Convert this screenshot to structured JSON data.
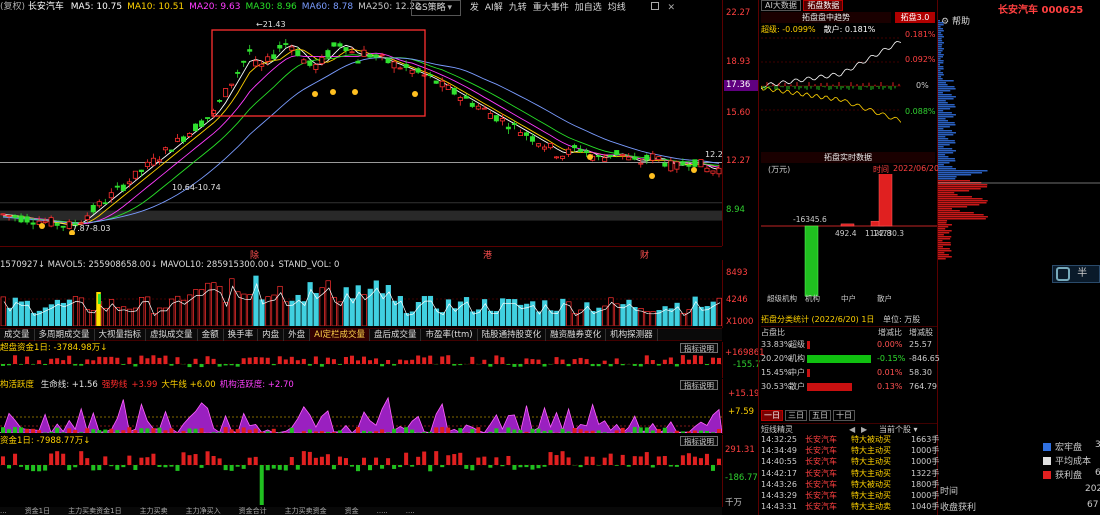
{
  "header": {
    "mode": "(复权)",
    "stock_name": "长安汽车",
    "ma_lines": [
      {
        "label": "MA5: 10.75",
        "color": "#ffffff"
      },
      {
        "label": "MA10: 10.51",
        "color": "#ffd200"
      },
      {
        "label": "MA20: 9.63",
        "color": "#ff3cff"
      },
      {
        "label": "MA30: 8.96",
        "color": "#28e028"
      },
      {
        "label": "MA60: 8.78",
        "color": "#7a9cff"
      },
      {
        "label": "MA250: 12.22",
        "color": "#c8c8c8"
      }
    ],
    "toolbar_select": "GS策略",
    "toolbar_items": [
      "发",
      "AI解",
      "九转",
      "重大事件",
      "加自选",
      "均线"
    ],
    "right_title": "长安汽车 000625"
  },
  "price_axis": [
    "22.27",
    "18.93",
    "17.36",
    "15.60",
    "12.27",
    "8.94"
  ],
  "price_notes": {
    "high": "21.43",
    "range1": "10.64-10.74",
    "range2": "7.87-8.03",
    "range3": "7.25-7.87",
    "low": "6.40",
    "right_price": "12.2"
  },
  "event_marks": [
    "除",
    "港",
    "财"
  ],
  "volume": {
    "header": "1570927↓ MAVOL5: 255908658.00↓ MAVOL10: 285915300.00↓ STAND_VOL: 0",
    "axis": [
      "8493",
      "4246",
      "X1000"
    ]
  },
  "tabs": [
    "成交量",
    "多周期成交量",
    "大视量指标",
    "虚拟成交量",
    "金额",
    "换手率",
    "内盘",
    "外盘",
    "AI定栏成交量",
    "盘后成交量",
    "市盈率(ttm)",
    "陆股通持股变化",
    "融资融券变化",
    "机构探测器"
  ],
  "active_tab_index": 8,
  "panels": {
    "p1_header": "超盘资金1日: -3784.98万↓",
    "p1_axis": [
      "+169861",
      "-155.7"
    ],
    "p2_header_prefix": "构活跃度",
    "p2_items": [
      {
        "label": "生命线: +1.56",
        "color": "#e0e0e0"
      },
      {
        "label": "强势线",
        "color": "#ff2c2c"
      },
      {
        "label": "+3.99",
        "color": "#ff2c2c"
      },
      {
        "label": "大牛线 +6.00",
        "color": "#ffd200"
      },
      {
        "label": "机构活跃度: +2.70",
        "color": "#ff40ff"
      }
    ],
    "p2_axis": [
      "+15.19",
      "+7.59"
    ],
    "p3_header": "资金1日: -7988.77万↓",
    "p3_axis": [
      "291.31",
      "-186.77"
    ],
    "p3_unit": "千万",
    "explain_label": "指标说明"
  },
  "bottom_strip": [
    "...",
    "资金1日",
    "主力买卖资金1日",
    "主力买卖",
    "主力净买入",
    "资金合计",
    "主力买卖资金",
    "资金",
    ".....",
    "...."
  ],
  "right_panel": {
    "top_tabs": [
      "AI大数据",
      "拓盘数据"
    ],
    "trend_title": "拓盘盘中趋势",
    "trend_badge": "拓盘3.0",
    "help": "帮助",
    "trend_legend": [
      {
        "label": "超级: -0.099%",
        "color": "#ffd200"
      },
      {
        "label": "散户: 0.181%",
        "color": "#ffffff"
      }
    ],
    "trend_axis": [
      "0.181%",
      "0.092%",
      "0%",
      "0.088%"
    ],
    "realtime_title": "拓盘实时数据",
    "realtime_unit": "(万元)",
    "realtime_time_label": "时间",
    "realtime_date": "2022/06/20",
    "bars": [
      {
        "label": "超级机构",
        "value": -16345.6,
        "text": "-16345.6"
      },
      {
        "label": "机构",
        "value": 492.4,
        "text": "492.4"
      },
      {
        "label": "中户",
        "value": 1122.8,
        "text": "1122.8"
      },
      {
        "label": "散户",
        "value": 14730.3,
        "text": "14730.3"
      }
    ],
    "bar_caption": "拓盘分类统计 (2022/6/20) 1日",
    "bar_unit": "单位: 万股",
    "table_head": [
      "占盘比",
      "",
      "",
      "增减比",
      "增减股"
    ],
    "table_rows": [
      {
        "pct": "33.83%",
        "name": "超级",
        "bar_color": "#c81010",
        "bar_len": 0.05,
        "ratio": "0.00%",
        "qty": "25.57",
        "ratio_color": "#ff5050"
      },
      {
        "pct": "20.20%",
        "name": "机构",
        "bar_color": "#10c010",
        "bar_len": 1.0,
        "ratio": "-0.15%",
        "qty": "-846.65",
        "ratio_color": "#30e030"
      },
      {
        "pct": "15.45%",
        "name": "中户",
        "bar_color": "#c81010",
        "bar_len": 0.05,
        "ratio": "0.01%",
        "qty": "58.30",
        "ratio_color": "#ff5050"
      },
      {
        "pct": "30.53%",
        "name": "散户",
        "bar_color": "#c81010",
        "bar_len": 0.7,
        "ratio": "0.13%",
        "qty": "764.79",
        "ratio_color": "#ff5050"
      }
    ],
    "day_tabs": [
      "一日",
      "三日",
      "五日",
      "十日"
    ],
    "tick_title": "短线精灵",
    "tick_dropdown": "当前个股",
    "ticks": [
      {
        "time": "14:32:25",
        "name": "长安汽车",
        "type": "特大被动买",
        "vol": "1663手",
        "color": "#ff4040"
      },
      {
        "time": "14:34:49",
        "name": "长安汽车",
        "type": "特大主动买",
        "vol": "1000手",
        "color": "#ff4040"
      },
      {
        "time": "14:40:55",
        "name": "长安汽车",
        "type": "特大主动买",
        "vol": "1000手",
        "color": "#ff4040"
      },
      {
        "time": "14:42:17",
        "name": "长安汽车",
        "type": "特大主动买",
        "vol": "1322手",
        "color": "#ff4040"
      },
      {
        "time": "14:43:26",
        "name": "长安汽车",
        "type": "特大被动买",
        "vol": "1800手",
        "color": "#ff4040"
      },
      {
        "time": "14:43:29",
        "name": "长安汽车",
        "type": "特大主动买",
        "vol": "1000手",
        "color": "#ff4040"
      },
      {
        "time": "14:43:31",
        "name": "长安汽车",
        "type": "特大主动卖",
        "vol": "1040手",
        "color": "#ff4040"
      }
    ]
  },
  "far_right": {
    "search_hint": "半",
    "legend": [
      {
        "label": "宏牢盘",
        "color": "#3070e0",
        "val": "3"
      },
      {
        "label": "平均成本",
        "color": "#e0e0e0",
        "val": ""
      },
      {
        "label": "获利盘",
        "color": "#e02020",
        "val": "6"
      }
    ],
    "time_label": "时间",
    "time_val": "202",
    "profit_label": "收盘获利",
    "profit_val": "67"
  }
}
